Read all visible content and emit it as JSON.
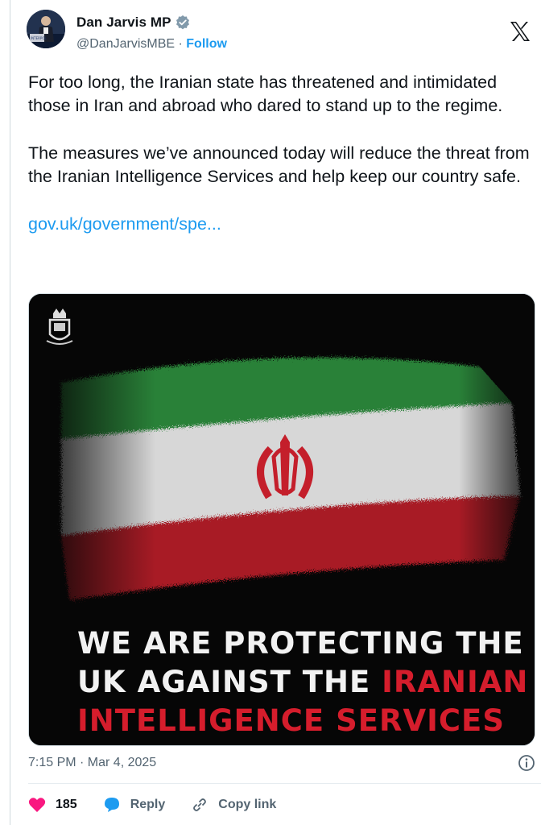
{
  "author": {
    "name": "Dan Jarvis MP",
    "handle": "@DanJarvisMBE",
    "separator": "·",
    "follow_label": "Follow"
  },
  "tweet": {
    "paragraph1": "For too long, the Iranian state has threatened and intimidated those in Iran and abroad who dared to stand up to the regime.",
    "paragraph2": "The measures we’ve announced today will reduce the threat from the Iranian Intelligence Services and help keep our country safe.",
    "link": "gov.uk/government/spe..."
  },
  "media": {
    "caption_line1": "WE ARE PROTECTING THE",
    "caption_line2_white": "UK AGAINST THE ",
    "caption_line2_red": "IRANIAN",
    "caption_line3": "INTELLIGENCE SERVICES",
    "flag_colors": {
      "green": "#2f8f3f",
      "white": "#e9e9e9",
      "red": "#c41f2b"
    }
  },
  "timestamp": "7:15 PM · Mar 4, 2025",
  "actions": {
    "like_count": "185",
    "reply_label": "Reply",
    "copy_label": "Copy link"
  },
  "colors": {
    "accent": "#1d9bf0",
    "like": "#f91880",
    "muted": "#536471"
  }
}
